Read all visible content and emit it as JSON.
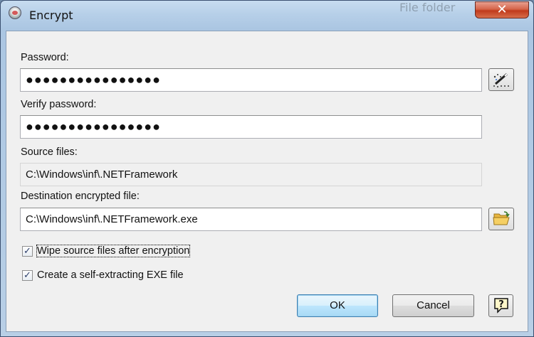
{
  "window": {
    "title": "Encrypt",
    "close_symbol": "✕",
    "ghost_text": [
      "File folder",
      "File folder"
    ]
  },
  "form": {
    "password_label": "Password:",
    "password_value": "●●●●●●●●●●●●●●●●",
    "verify_label": "Verify password:",
    "verify_value": "●●●●●●●●●●●●●●●●",
    "source_label": "Source files:",
    "source_value": "C:\\Windows\\inf\\.NETFramework",
    "dest_label": "Destination encrypted file:",
    "dest_value": "C:\\Windows\\inf\\.NETFramework.exe",
    "wipe_label": "Wipe source files after encryption",
    "wipe_checked": true,
    "sfx_label": "Create a self-extracting EXE file",
    "sfx_checked": true,
    "check_mark": "✓"
  },
  "buttons": {
    "ok_label": "OK",
    "cancel_label": "Cancel",
    "help_symbol": "?"
  },
  "icons": {
    "password_generator": "wand-icon",
    "browse": "folder-open-icon",
    "help": "help-icon"
  },
  "colors": {
    "titlebar": "#b6cfe8",
    "close_button": "#c8472a",
    "default_button": "#bee6fd",
    "dialog_bg": "#f0f0f0"
  }
}
